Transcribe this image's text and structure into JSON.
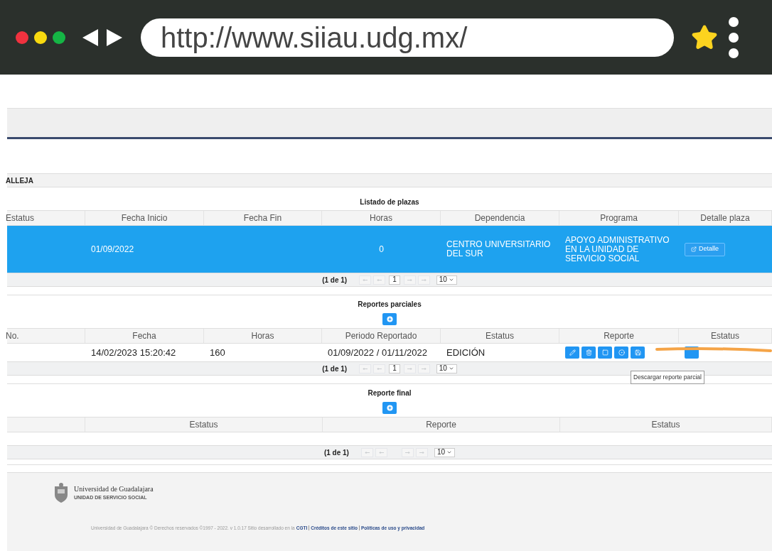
{
  "browser": {
    "url": "http://www.siiau.udg.mx/"
  },
  "header_label": "ALLEJA",
  "plazas": {
    "title": "Listado de plazas",
    "columns": [
      "Estatus",
      "Fecha Inicio",
      "Fecha Fin",
      "Horas",
      "Dependencia",
      "Programa",
      "Detalle plaza"
    ],
    "rows": [
      {
        "selected": true,
        "cells": [
          "",
          "01/09/2022",
          "",
          "0",
          "CENTRO UNIVERSITARIO DEL SUR",
          "APOYO ADMINISTRATIVO EN LA UNIDAD DE SERVICIO SOCIAL"
        ],
        "button": "Detalle"
      }
    ],
    "pager": {
      "summary": "(1 de 1)",
      "page": "1",
      "size": "10"
    }
  },
  "parciales": {
    "title": "Reportes parciales",
    "columns": [
      "No.",
      "Fecha",
      "Horas",
      "Periodo Reportado",
      "Estatus",
      "Reporte",
      "Estatus"
    ],
    "rows": [
      {
        "cells": [
          "",
          "14/02/2023 15:20:42",
          "160",
          "01/09/2022 / 01/11/2022",
          "EDICIÓN"
        ]
      }
    ],
    "tooltip": "Descargar reporte parcial",
    "pager": {
      "summary": "(1 de 1)",
      "page": "1",
      "size": "10"
    }
  },
  "final": {
    "title": "Reporte final",
    "columns": [
      "",
      "Estatus",
      "Reporte",
      "Estatus"
    ],
    "pager": {
      "summary": "(1 de 1)",
      "size": "10"
    }
  },
  "footer": {
    "logo_title": "Universidad de Guadalajara",
    "logo_subtitle": "UNIDAD DE SERVICIO SOCIAL",
    "copyright": "Universidad de Guadalajara © Derechos reservados ©1997 - 2022. v 1.0.17 Sitio desarrollado en la",
    "links": [
      "CGTI",
      "Créditos de este sitio",
      "Políticas de uso y privacidad"
    ]
  }
}
